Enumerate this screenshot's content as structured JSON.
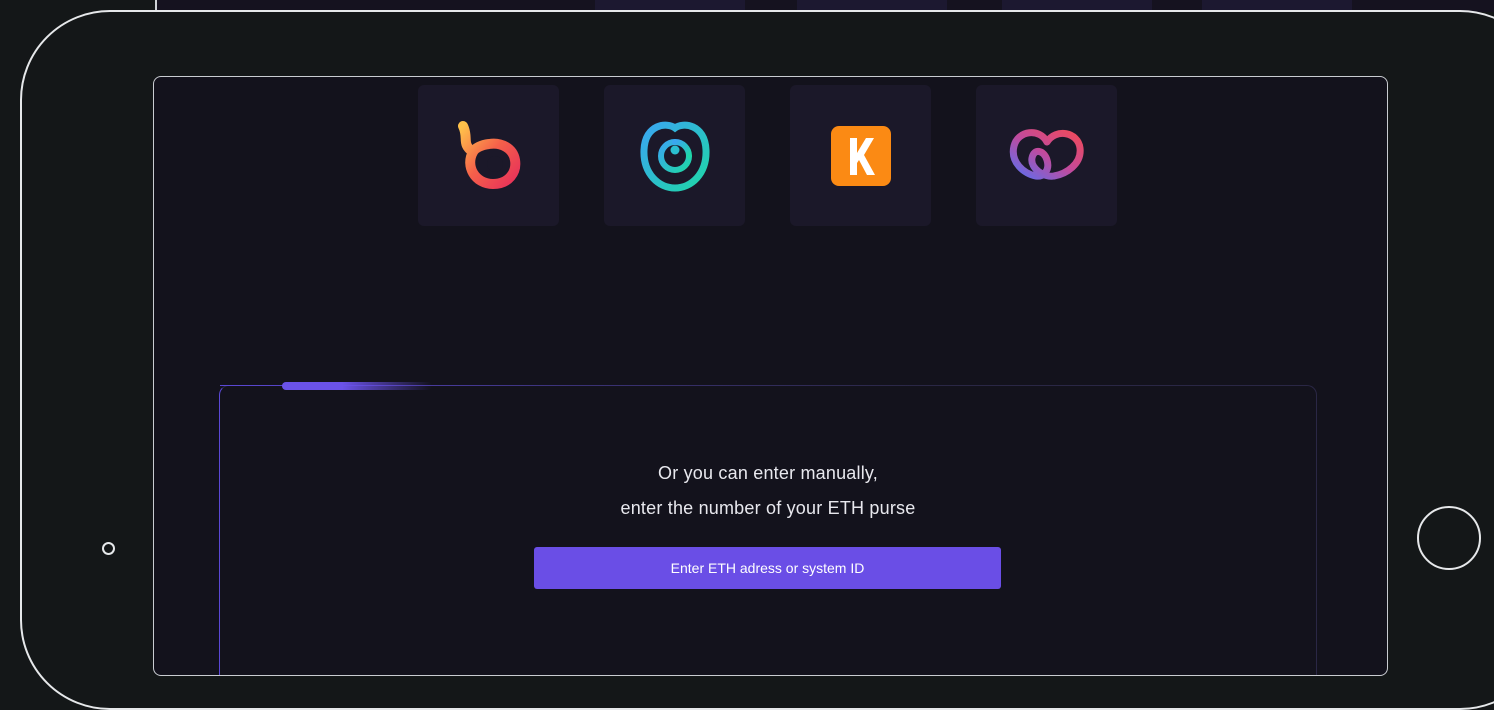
{
  "wallets": [
    {
      "name": "wallet-1",
      "icon": "flame-loop-logo-icon"
    },
    {
      "name": "wallet-2",
      "icon": "teal-target-logo-icon"
    },
    {
      "name": "wallet-3",
      "icon": "orange-k-logo-icon",
      "letter": "K"
    },
    {
      "name": "wallet-4",
      "icon": "gradient-heart-loop-logo-icon"
    }
  ],
  "manual": {
    "line1": "Or you can enter manually,",
    "line2": "enter the number of your ETH purse",
    "button_label": "Enter ETH adress or system ID"
  },
  "colors": {
    "background": "#141718",
    "screen": "#13121c",
    "card": "#1b1829",
    "accent": "#6a4ee6",
    "device_outline": "#e6e8ea"
  }
}
